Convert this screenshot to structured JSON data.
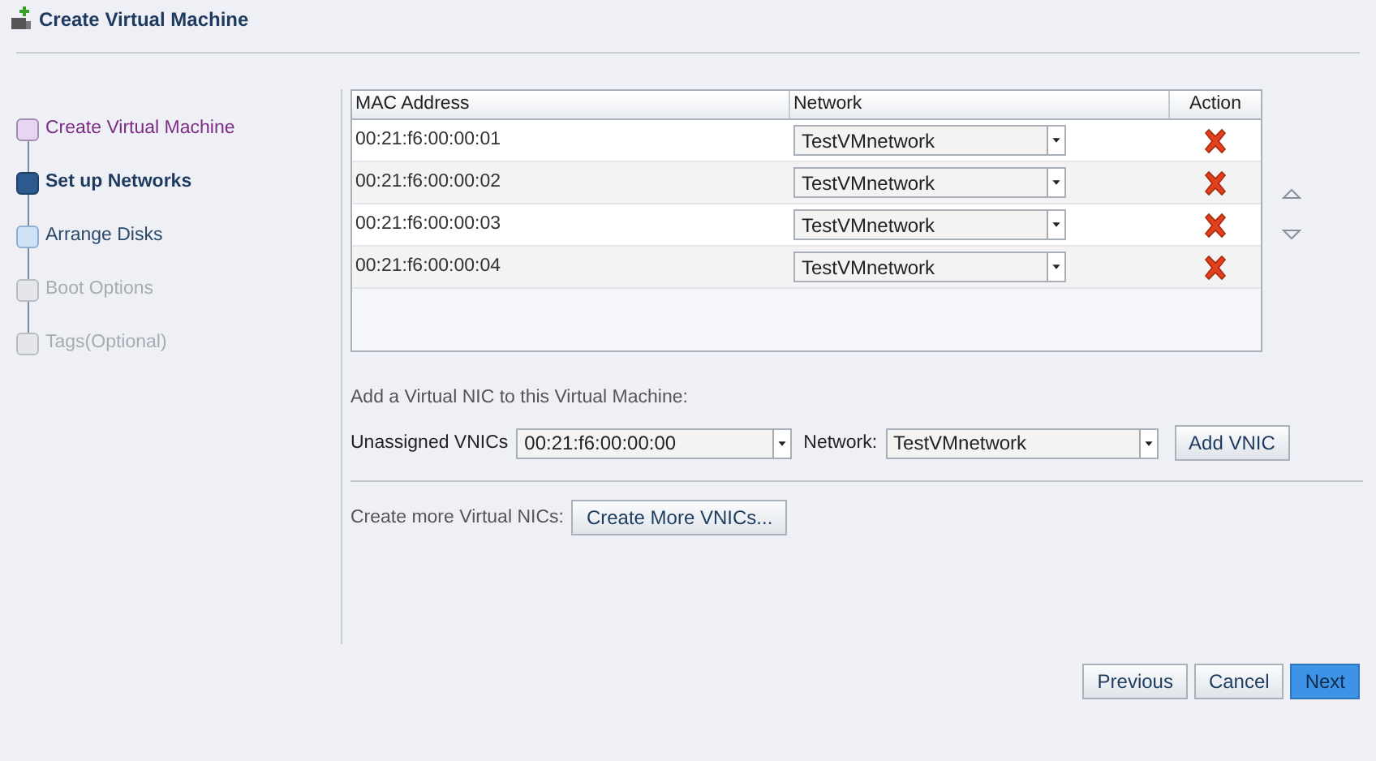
{
  "window": {
    "title": "Create Virtual Machine"
  },
  "steps": [
    {
      "label": "Create Virtual Machine",
      "visited": true,
      "selected": false,
      "disabled": false
    },
    {
      "label": "Set up Networks",
      "visited": false,
      "selected": true,
      "disabled": false
    },
    {
      "label": "Arrange Disks",
      "visited": false,
      "selected": false,
      "disabled": false
    },
    {
      "label": "Boot Options",
      "visited": false,
      "selected": false,
      "disabled": true
    },
    {
      "label": "Tags(Optional)",
      "visited": false,
      "selected": false,
      "disabled": true
    }
  ],
  "table": {
    "columns": [
      "MAC Address",
      "Network",
      "Action"
    ],
    "rows": [
      {
        "mac": "00:21:f6:00:00:01",
        "network": "TestVMnetwork"
      },
      {
        "mac": "00:21:f6:00:00:02",
        "network": "TestVMnetwork"
      },
      {
        "mac": "00:21:f6:00:00:03",
        "network": "TestVMnetwork"
      },
      {
        "mac": "00:21:f6:00:00:04",
        "network": "TestVMnetwork"
      }
    ]
  },
  "add_vnic": {
    "heading": "Add a Virtual NIC to this Virtual Machine:",
    "unassigned_label": "Unassigned VNICs",
    "unassigned_value": "00:21:f6:00:00:00",
    "network_label": "Network:",
    "network_value": "TestVMnetwork",
    "button": "Add VNIC"
  },
  "create_more": {
    "label": "Create more Virtual NICs:",
    "button": "Create More VNICs..."
  },
  "buttons": [
    {
      "label": "Previous",
      "primary": false
    },
    {
      "label": "Cancel",
      "primary": false
    },
    {
      "label": "Next",
      "primary": true
    }
  ]
}
